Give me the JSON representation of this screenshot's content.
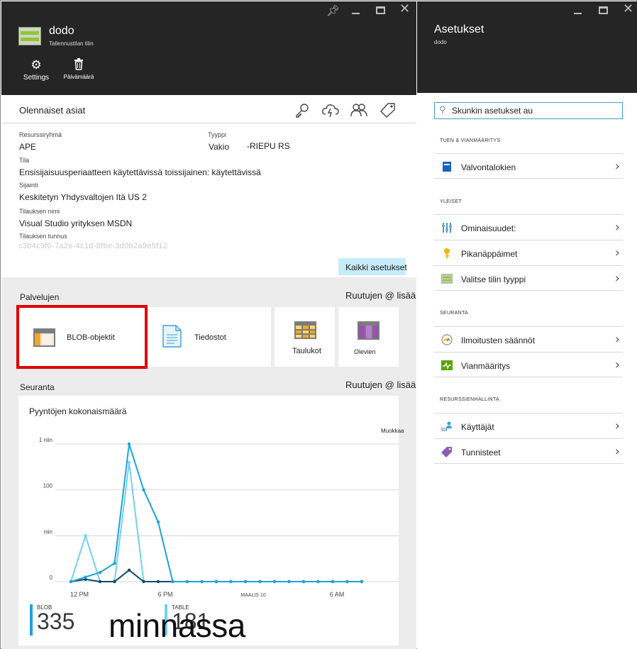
{
  "left_blade": {
    "title": "dodo",
    "subtitle": "Tallennustilan tilin",
    "commands": [
      {
        "label": "Settings",
        "icon": "gear-icon"
      },
      {
        "label": "Päivämäärä",
        "icon": "trash-icon"
      }
    ],
    "essentials": {
      "title": "Olennaiset asiat",
      "icons": [
        "key-icon",
        "cloud-lightning-icon",
        "users-icon",
        "tag-icon"
      ],
      "resource_group_label": "Resurssiryhmä",
      "resource_group_value": "APE",
      "type_label": "Tyyppi",
      "type_value": "Vakio",
      "type_value_extra": "-RIEPU RS",
      "status_label": "Tila",
      "status_value": "Ensisijaisuusperiaatteen käytettävissä toissijainen: käytettävissä",
      "location_label": "Sijainti",
      "location_value": "Keskitetyn Yhdysvaltojen Itä US 2",
      "subscription_name_label": "Tilauksen nimi",
      "subscription_name_value": "Visual Studio yrityksen MSDN",
      "subscription_id_label": "Tilauksen tunnus",
      "subscription_id_value": "c3b4c9f0-7a2e-4c1d-8f6e-3d0b2a9e5f12",
      "all_settings_label": "Kaikki asetukset"
    },
    "services": {
      "label": "Palvelujen",
      "add_tiles_label": "Ruutujen @ lisääminen",
      "tiles": [
        {
          "label": "BLOB-objektit",
          "icon": "blob-icon"
        },
        {
          "label": "Tiedostot",
          "icon": "file-icon"
        },
        {
          "label": "Taulukot",
          "icon": "table-icon"
        },
        {
          "label": "Olevien",
          "icon": "queue-icon"
        }
      ]
    },
    "monitoring": {
      "label": "Seuranta",
      "add_tiles_label": "Ruutujen @ lisääminen",
      "chart_edit_label": "Muokkaa",
      "metrics": [
        {
          "name": "BLOB",
          "value": "335"
        },
        {
          "name": "TABLE",
          "value": "181"
        }
      ],
      "overlay_text": "minnassa"
    }
  },
  "chart_data": {
    "type": "line",
    "title": "Pyyntöjen kokonaismäärä",
    "ytick_labels": [
      "1 niin",
      "100",
      "niin",
      "0"
    ],
    "xtick_labels": [
      "12 PM",
      "6 PM",
      "MAALIS 10",
      "6 AM"
    ],
    "ylim": [
      0,
      300
    ],
    "grid": true,
    "colors": [
      "#1ea3dc",
      "#6fd2ee",
      "#0d4c6e"
    ],
    "x_count": 21,
    "series": [
      {
        "values": [
          0,
          10,
          20,
          40,
          300,
          200,
          130,
          0,
          0,
          0,
          0,
          0,
          0,
          0,
          0,
          0,
          0,
          0,
          0,
          0,
          0
        ]
      },
      {
        "values": [
          0,
          100,
          0,
          0,
          260,
          0,
          0,
          0,
          0,
          0,
          0,
          0,
          0,
          0,
          0,
          0,
          0,
          0,
          0,
          0,
          0
        ]
      },
      {
        "values": [
          0,
          5,
          0,
          0,
          25,
          0,
          0,
          0,
          0,
          0,
          0,
          0,
          0,
          0,
          0,
          0,
          0,
          0,
          0,
          0,
          0
        ]
      }
    ]
  },
  "right_blade": {
    "title": "Asetukset",
    "subtitle": "dodo",
    "search_value": "Skunkin asetukset au",
    "sections": [
      {
        "label": "TUEN & VIANMÄÄRITYS",
        "items": [
          {
            "label": "Valvontalokien",
            "icon": "audit-log-icon"
          }
        ]
      },
      {
        "label": "YLEISET",
        "items": [
          {
            "label": "Ominaisuudet:",
            "icon": "properties-icon"
          },
          {
            "label": "Pikanäppäimet",
            "icon": "key-icon"
          },
          {
            "label": "Valitse tilin tyyppi",
            "icon": "account-type-icon"
          }
        ]
      },
      {
        "label": "SEURANTA",
        "items": [
          {
            "label": "Ilmoitusten säännöt",
            "icon": "alert-rules-icon"
          },
          {
            "label": "Vianmääritys",
            "icon": "diagnostics-icon"
          }
        ]
      },
      {
        "label": "RESURSSIENHALLINTA",
        "items": [
          {
            "label": "Käyttäjät",
            "icon": "users-icon"
          },
          {
            "label": "Tunnisteet",
            "icon": "tag-icon"
          }
        ]
      }
    ]
  }
}
